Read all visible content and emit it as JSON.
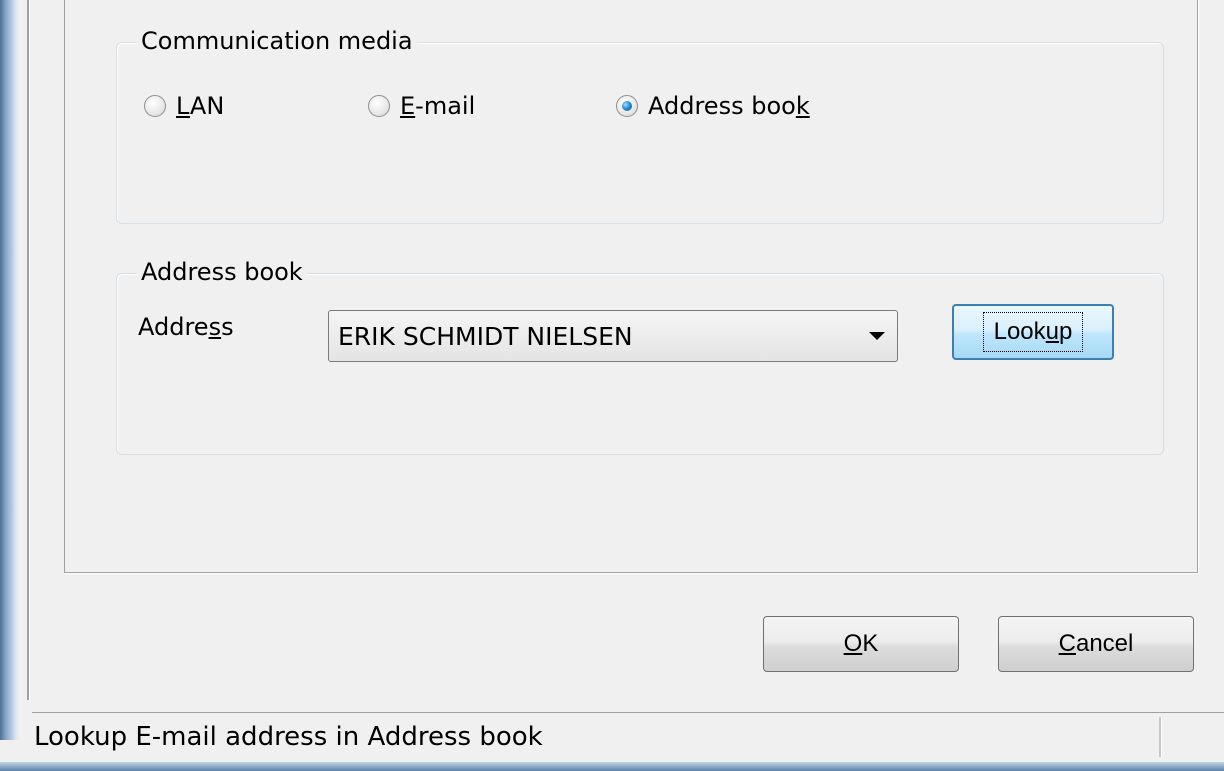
{
  "communication_media": {
    "legend": "Communication media",
    "options": [
      {
        "label_mnemonic": "L",
        "label_rest": "AN",
        "checked": false
      },
      {
        "label_mnemonic": "E",
        "label_rest": "-mail",
        "checked": false
      },
      {
        "label_pre": "Address boo",
        "label_mnemonic": "k",
        "checked": true
      }
    ]
  },
  "address_book": {
    "legend": "Address book",
    "address_label_pre": "Addre",
    "address_label_mnemonic": "s",
    "address_label_post": "s",
    "selected_address": "ERIK SCHMIDT NIELSEN",
    "lookup_pre": "Look",
    "lookup_mnemonic": "u",
    "lookup_post": "p"
  },
  "buttons": {
    "ok_mnemonic": "O",
    "ok_rest": "K",
    "cancel_mnemonic": "C",
    "cancel_rest": "ancel"
  },
  "status_bar": {
    "text": "Lookup E-mail address in Address book"
  },
  "colors": {
    "accent_focus": "#3c7fb1",
    "radio_selected": "#2c8fd6",
    "window_bg": "#f0f0f0"
  }
}
